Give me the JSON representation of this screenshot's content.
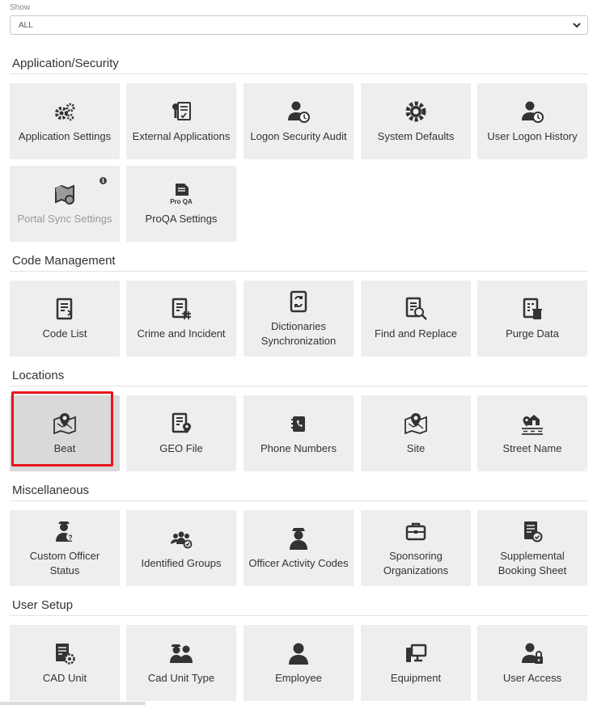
{
  "filter": {
    "label": "Show",
    "value": "ALL"
  },
  "sections": [
    {
      "title": "Application/Security",
      "tiles": [
        {
          "label": "Application Settings",
          "icon": "gears-icon"
        },
        {
          "label": "External Applications",
          "icon": "key-document-icon"
        },
        {
          "label": "Logon Security Audit",
          "icon": "user-clock-icon"
        },
        {
          "label": "System Defaults",
          "icon": "gear-icon"
        },
        {
          "label": "User Logon History",
          "icon": "user-clock-icon"
        },
        {
          "label": "Portal Sync Settings",
          "icon": "map-sync-icon",
          "disabled": true,
          "info": "i"
        },
        {
          "label": "ProQA Settings",
          "icon": "proqa-document-icon",
          "icon_text": "Pro QA"
        }
      ]
    },
    {
      "title": "Code Management",
      "tiles": [
        {
          "label": "Code List",
          "icon": "code-document-icon"
        },
        {
          "label": "Crime and Incident",
          "icon": "hash-document-icon"
        },
        {
          "label": "Dictionaries Synchronization",
          "icon": "sync-book-icon"
        },
        {
          "label": "Find and Replace",
          "icon": "search-document-icon"
        },
        {
          "label": "Purge Data",
          "icon": "purge-document-icon"
        }
      ]
    },
    {
      "title": "Locations",
      "tiles": [
        {
          "label": "Beat",
          "icon": "map-pin-icon",
          "selected": true
        },
        {
          "label": "GEO File",
          "icon": "pin-document-icon"
        },
        {
          "label": "Phone Numbers",
          "icon": "phone-book-icon"
        },
        {
          "label": "Site",
          "icon": "map-pin-icon"
        },
        {
          "label": "Street Name",
          "icon": "street-house-icon"
        }
      ]
    },
    {
      "title": "Miscellaneous",
      "tiles": [
        {
          "label": "Custom Officer Status",
          "icon": "officer-question-icon"
        },
        {
          "label": "Identified Groups",
          "icon": "group-check-icon"
        },
        {
          "label": "Officer Activity Codes",
          "icon": "officer-icon"
        },
        {
          "label": "Sponsoring Organizations",
          "icon": "briefcase-icon"
        },
        {
          "label": "Supplemental Booking Sheet",
          "icon": "check-document-icon"
        }
      ]
    },
    {
      "title": "User Setup",
      "tiles": [
        {
          "label": "CAD Unit",
          "icon": "gear-document-icon"
        },
        {
          "label": "Cad Unit Type",
          "icon": "officers-icon"
        },
        {
          "label": "Employee",
          "icon": "user-icon"
        },
        {
          "label": "Equipment",
          "icon": "computer-icon"
        },
        {
          "label": "User Access",
          "icon": "user-lock-icon"
        }
      ]
    }
  ]
}
